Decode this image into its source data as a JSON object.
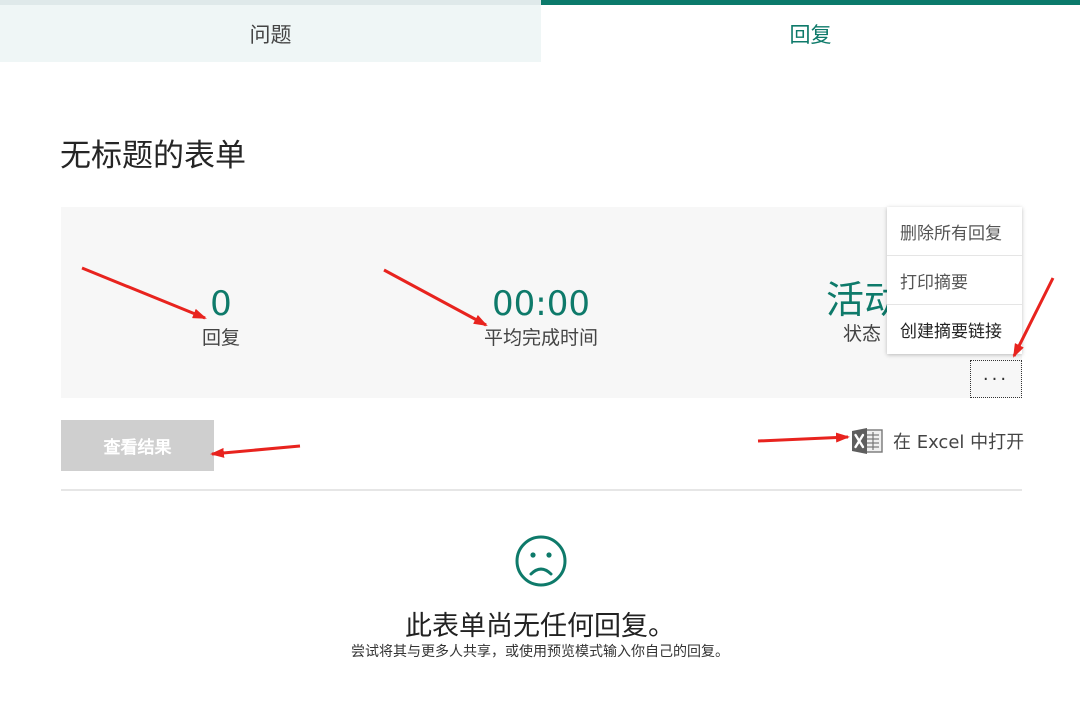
{
  "tabs": {
    "questions": "问题",
    "responses": "回复"
  },
  "form_title": "无标题的表单",
  "stats": {
    "responses_value": "0",
    "responses_label": "回复",
    "avg_time_value": "00:00",
    "avg_time_label": "平均完成时间",
    "status_value": "活动",
    "status_label": "状态"
  },
  "menu": {
    "delete_all": "删除所有回复",
    "print_summary": "打印摘要",
    "create_summary_link": "创建摘要链接"
  },
  "more_button": "···",
  "view_results": "查看结果",
  "excel_link": "在 Excel 中打开",
  "empty": {
    "title": "此表单尚无任何回复。",
    "subtitle": "尝试将其与更多人共享，或使用预览模式输入你自己的回复。"
  },
  "colors": {
    "accent": "#0e7a6a",
    "annotation_arrow": "#e8231e"
  },
  "icons": [
    "excel-icon",
    "sad-face-icon",
    "more-icon"
  ]
}
